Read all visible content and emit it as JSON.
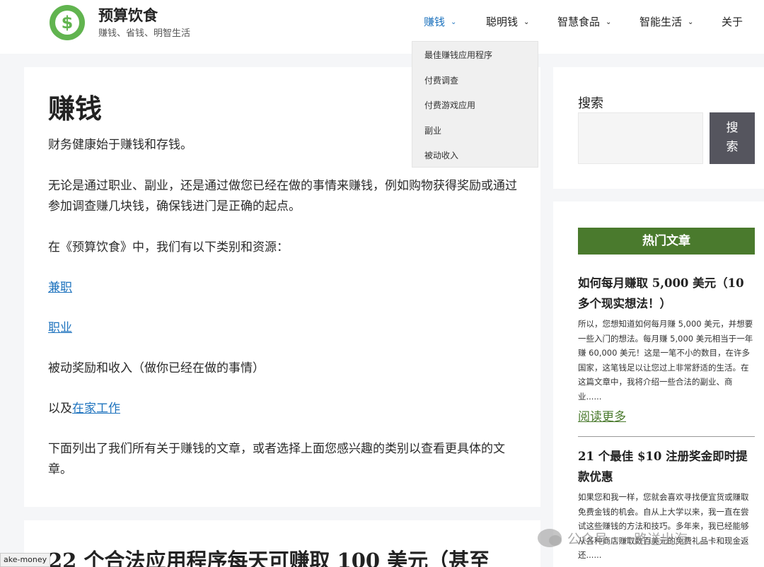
{
  "header": {
    "site_title": "预算饮食",
    "tagline": "赚钱、省钱、明智生活",
    "logo_symbol": "$",
    "logo_color": "#61b44f"
  },
  "nav": {
    "items": [
      {
        "label": "赚钱",
        "active": true,
        "has_dropdown": true
      },
      {
        "label": "聪明钱",
        "has_dropdown": true
      },
      {
        "label": "智慧食品",
        "has_dropdown": true
      },
      {
        "label": "智能生活",
        "has_dropdown": true
      },
      {
        "label": "关于",
        "has_dropdown": false
      }
    ],
    "dropdown": [
      "最佳赚钱应用程序",
      "付费调查",
      "付费游戏应用",
      "副业",
      "被动收入"
    ],
    "active_color": "#1e73be"
  },
  "main": {
    "title": "赚钱",
    "p1": "财务健康始于赚钱和存钱。",
    "p2": "无论是通过职业、副业，还是通过做您已经在做的事情来赚钱，例如购物获得奖励或通过参加调查赚几块钱，确保钱进门是正确的起点。",
    "p3": "在《预算饮食》中，我们有以下类别和资源：",
    "link_parttime": "兼职",
    "link_career": "职业",
    "p_passive": "被动奖励和收入（做你已经在做的事情）",
    "p_wfh_prefix": "以及",
    "link_wfh": "在家工作",
    "p_bottom": "下面列出了我们所有关于赚钱的文章，或者选择上面您感兴趣的类别以查看更具体的文章。",
    "article_heading": "22 个合法应用程序每天可赚取 100 美元（甚至"
  },
  "sidebar": {
    "search_label": "搜索",
    "search_placeholder": "",
    "search_button": "搜索",
    "hot_title": "热门文章",
    "hot_color": "#4a7a2d",
    "article1_title": "如何每月赚取 5,000 美元（10 多个现实想法！）",
    "article1_body": "所以，您想知道如何每月赚 5,000 美元，并想要一些入门的想法。每月赚 5,000 美元相当于一年赚 60,000 美元！这是一笔不小的数目，在许多国家，这笔钱足以让您过上非常舒适的生活。在这篇文章中，我将介绍一些合法的副业、商业......",
    "read_more": "阅读更多",
    "article2_title": "21 个最佳 $10 注册奖金即时提款优惠",
    "article2_body": "如果您和我一样，您就会喜欢寻找便宜货或赚取免费金钱的机会。自从上大学以来，我一直在尝试这些赚钱的方法和技巧。多年来，我已经能够从各种商店赚取数百美元的免费礼品卡和现金返还......"
  },
  "status_bar": "ake-money",
  "watermark": "公众号 · 一路送出海"
}
